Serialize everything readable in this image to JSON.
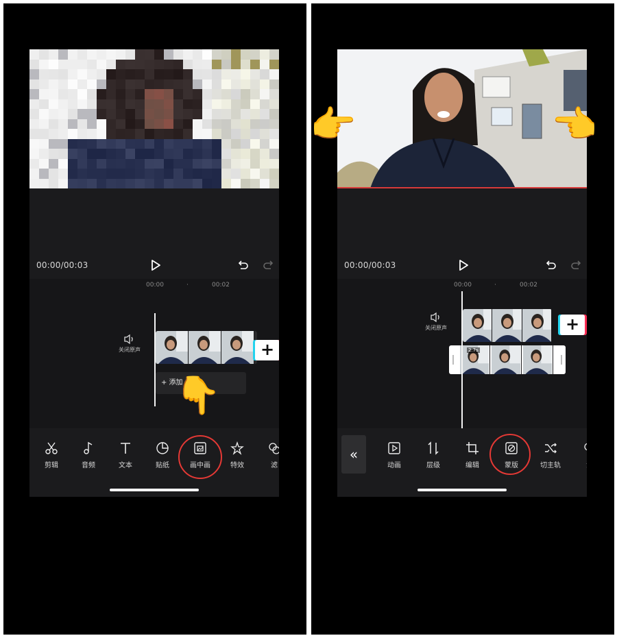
{
  "left": {
    "time_display": "00:00/00:03",
    "ruler": [
      "00:00",
      "00:02"
    ],
    "mute_label": "关闭原声",
    "add_audio_label": "+ 添加",
    "toolbar": [
      {
        "label": "剪辑",
        "icon": "scissors-icon"
      },
      {
        "label": "音频",
        "icon": "music-note-icon"
      },
      {
        "label": "文本",
        "icon": "text-t-icon"
      },
      {
        "label": "贴纸",
        "icon": "sticker-icon"
      },
      {
        "label": "画中画",
        "icon": "picture-in-picture-icon"
      },
      {
        "label": "特效",
        "icon": "sparkle-star-icon"
      },
      {
        "label": "滤",
        "icon": "filter-icon"
      }
    ],
    "hand_emoji": "👇",
    "highlight_color": "#e53935"
  },
  "right": {
    "time_display": "00:00/00:03",
    "ruler": [
      "00:00",
      "00:02"
    ],
    "mute_label": "关闭原声",
    "pip_badge": "2.7s",
    "toolbar": [
      {
        "label": "动画",
        "icon": "play-square-icon"
      },
      {
        "label": "层级",
        "icon": "layer-order-icon"
      },
      {
        "label": "编辑",
        "icon": "crop-icon"
      },
      {
        "label": "蒙版",
        "icon": "mask-icon"
      },
      {
        "label": "切主轨",
        "icon": "shuffle-icon"
      },
      {
        "label": "滤",
        "icon": "filter-icon"
      }
    ],
    "collapse_glyph": "«",
    "hand_left_emoji": "👉",
    "hand_right_emoji": "👈",
    "highlight_color": "#e53935"
  }
}
